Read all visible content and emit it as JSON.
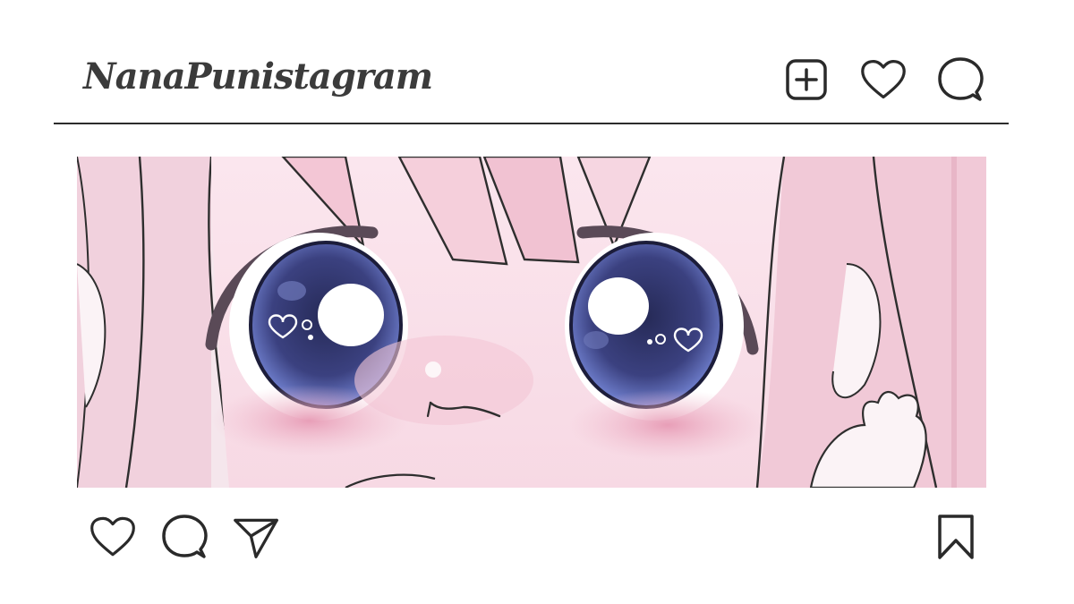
{
  "header": {
    "logo_text": "NanaPunistagram",
    "icons": [
      "add-post-icon",
      "heart-icon",
      "comment-icon"
    ]
  },
  "post": {
    "image_description_icon": "anime-girl-eyes-closeup",
    "actions": [
      "heart-icon",
      "comment-icon",
      "send-icon"
    ],
    "save_icon": "bookmark-icon"
  },
  "colors": {
    "text": "#3b3b3b",
    "divider": "#2c2c2c",
    "pink": "#f3c8d6",
    "iris": "#3a3f78"
  }
}
